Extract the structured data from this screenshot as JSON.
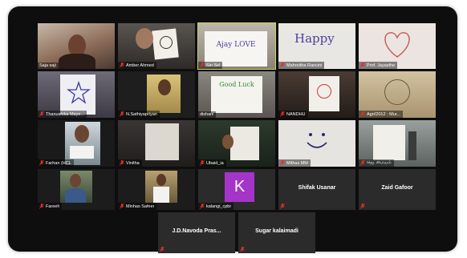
{
  "participants": [
    {
      "name": "Saja saji",
      "has_video": true
    },
    {
      "name": "Amber Ahmed",
      "has_video": true
    },
    {
      "name": "Sin Sel",
      "has_video": true,
      "active_speaker": true,
      "sign_text": "Ajay LOVE"
    },
    {
      "name": "Mahreitha Rancini",
      "has_video": true,
      "sign_text": "Happy"
    },
    {
      "name": "Prof. Jayasthe",
      "has_video": true
    },
    {
      "name": "Thanushika Maye...",
      "has_video": true
    },
    {
      "name": "N.Sathiyapriyan",
      "has_video": true
    },
    {
      "name": "dishani",
      "has_video": true,
      "sign_text": "Good Luck"
    },
    {
      "name": "NANDHU",
      "has_video": true
    },
    {
      "name": "Agri/2012 : Mur...",
      "has_video": true
    },
    {
      "name": "Farhan (HCL",
      "has_video": true
    },
    {
      "name": "Vinitha",
      "has_video": true
    },
    {
      "name": "Ubaid_ia",
      "has_video": true
    },
    {
      "name": "Mithas MM",
      "has_video": true
    },
    {
      "name": "ஜெ. மையம்",
      "has_video": true
    },
    {
      "name": "Fareeh",
      "has_video": true
    },
    {
      "name": "Minhas Safeer",
      "has_video": true
    },
    {
      "name": "kalangi_cpbr",
      "has_video": false,
      "avatar_letter": "K"
    },
    {
      "name": "Shifak Usanar",
      "has_video": false
    },
    {
      "name": "Zaid Gafoor",
      "has_video": false
    },
    {
      "name": "J.D.Navoda Pras...",
      "has_video": false
    },
    {
      "name": "Sugar kalaimadi",
      "has_video": false
    }
  ],
  "colors": {
    "background": "#0e0e0e",
    "tile": "#2b2b2b",
    "active_outline": "#c9d94a",
    "muted_mic": "#e0302b",
    "avatar": "#a435c8"
  }
}
